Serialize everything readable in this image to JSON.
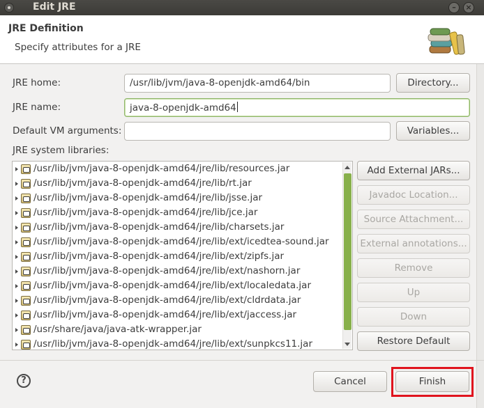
{
  "window": {
    "title": "Edit JRE"
  },
  "header": {
    "title": "JRE Definition",
    "description": "Specify attributes for a JRE"
  },
  "form": {
    "jre_home_label": "JRE home:",
    "jre_home_value": "/usr/lib/jvm/java-8-openjdk-amd64/bin",
    "directory_button": "Directory...",
    "jre_name_label": "JRE name:",
    "jre_name_value": "java-8-openjdk-amd64",
    "vm_args_label": "Default VM arguments:",
    "vm_args_value": "",
    "variables_button": "Variables...",
    "libraries_label": "JRE system libraries:"
  },
  "libraries": [
    "/usr/lib/jvm/java-8-openjdk-amd64/jre/lib/resources.jar",
    "/usr/lib/jvm/java-8-openjdk-amd64/jre/lib/rt.jar",
    "/usr/lib/jvm/java-8-openjdk-amd64/jre/lib/jsse.jar",
    "/usr/lib/jvm/java-8-openjdk-amd64/jre/lib/jce.jar",
    "/usr/lib/jvm/java-8-openjdk-amd64/jre/lib/charsets.jar",
    "/usr/lib/jvm/java-8-openjdk-amd64/jre/lib/ext/icedtea-sound.jar",
    "/usr/lib/jvm/java-8-openjdk-amd64/jre/lib/ext/zipfs.jar",
    "/usr/lib/jvm/java-8-openjdk-amd64/jre/lib/ext/nashorn.jar",
    "/usr/lib/jvm/java-8-openjdk-amd64/jre/lib/ext/localedata.jar",
    "/usr/lib/jvm/java-8-openjdk-amd64/jre/lib/ext/cldrdata.jar",
    "/usr/lib/jvm/java-8-openjdk-amd64/jre/lib/ext/jaccess.jar",
    "/usr/share/java/java-atk-wrapper.jar",
    "/usr/lib/jvm/java-8-openjdk-amd64/jre/lib/ext/sunpkcs11.jar"
  ],
  "side_buttons": {
    "add_external_jars": "Add External JARs...",
    "javadoc_location": "Javadoc Location...",
    "source_attachment": "Source Attachment...",
    "external_annotations": "External annotations...",
    "remove": "Remove",
    "up": "Up",
    "down": "Down",
    "restore_default": "Restore Default"
  },
  "footer": {
    "help_icon": "?",
    "cancel": "Cancel",
    "finish": "Finish"
  },
  "colors": {
    "highlight_border": "#e0141e",
    "scrollbar_thumb": "#88b04b",
    "focus_border": "#8fb66b"
  }
}
